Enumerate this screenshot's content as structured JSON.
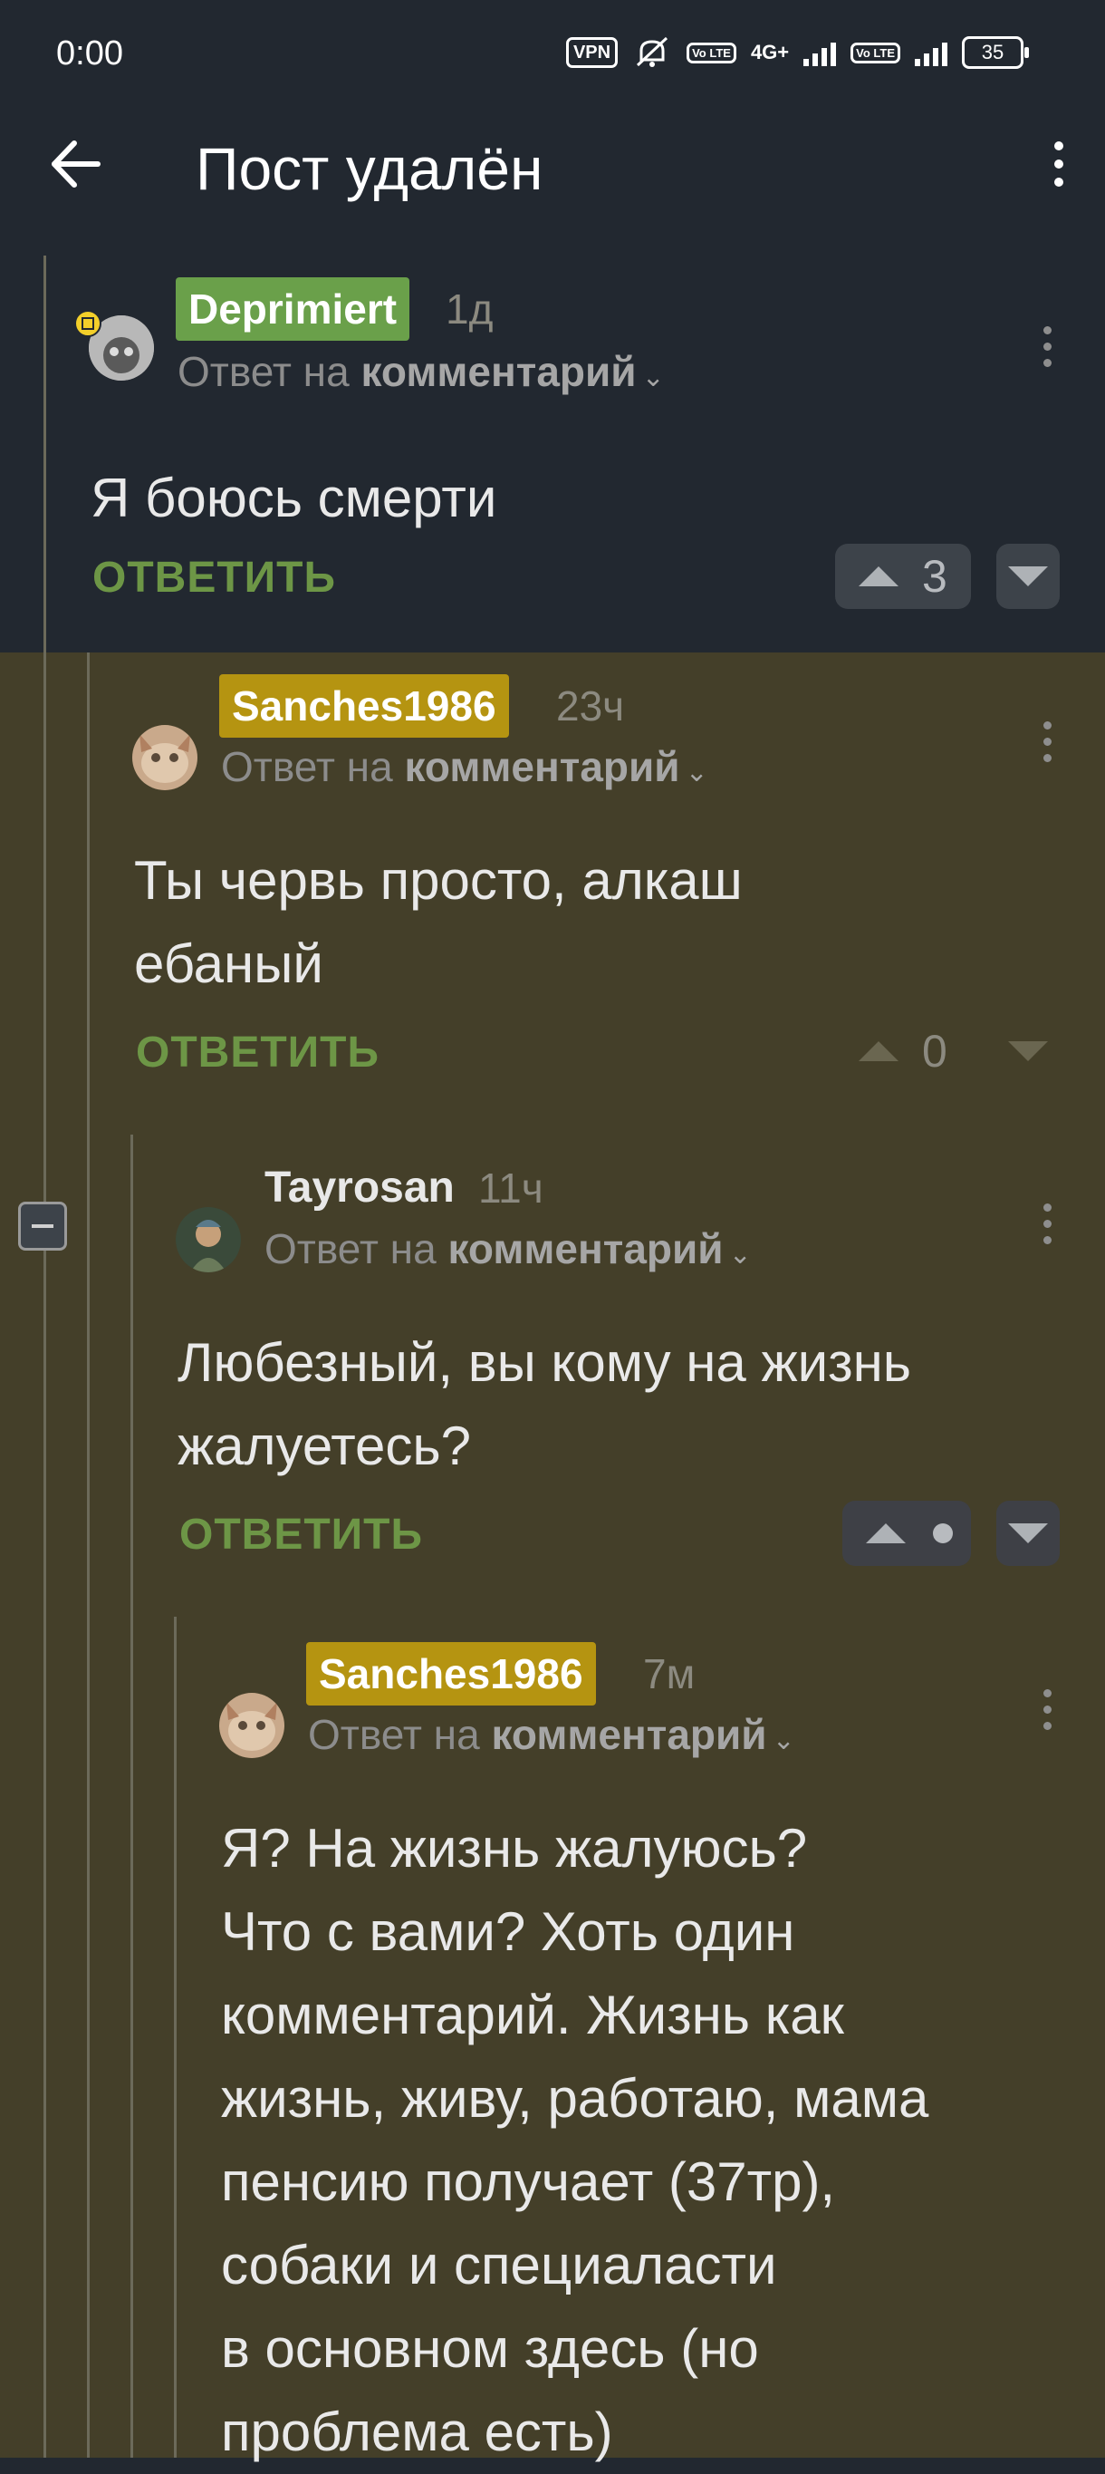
{
  "status": {
    "time": "0:00",
    "vpn": "VPN",
    "volte1": "Vo LTE",
    "net": "4G+",
    "volte2": "Vo LTE",
    "battery": "35"
  },
  "header": {
    "title": "Пост удалён",
    "back_icon": "arrow-left-icon",
    "menu_icon": "more-vertical-icon"
  },
  "comments": [
    {
      "nick": "Deprimiert",
      "nick_color": "#6aa04a",
      "time": "1д",
      "reply_prefix": "Ответ на",
      "reply_target": "комментарий",
      "text": "Я боюсь смерти",
      "reply_label": "ОТВЕТИТЬ",
      "votes": "3"
    },
    {
      "nick": "Sanches1986",
      "nick_color": "#b59411",
      "time": "23ч",
      "reply_prefix": "Ответ на",
      "reply_target": "комментарий",
      "text_line1": "Ты червь просто, алкаш",
      "text_line2": "ебаный",
      "reply_label": "ОТВЕТИТЬ",
      "votes": "0"
    },
    {
      "nick": "Tayrosan",
      "time": "11ч",
      "reply_prefix": "Ответ на",
      "reply_target": "комментарий",
      "text_line1": "Любезный, вы кому на жизнь",
      "text_line2": "жалуетесь?",
      "reply_label": "ОТВЕТИТЬ"
    },
    {
      "nick": "Sanches1986",
      "nick_color": "#b59411",
      "time": "7м",
      "reply_prefix": "Ответ на",
      "reply_target": "комментарий",
      "lines": [
        "Я? На жизнь жалуюсь?",
        "Что с вами? Хоть один",
        "комментарий. Жизнь как",
        "жизнь, живу, работаю, мама",
        "пенсию получает (37тр),",
        "собаки и специаласти",
        "в основном здесь (но",
        "проблема есть)"
      ]
    }
  ],
  "colors": {
    "dark_bg": "#222830",
    "olive_bg": "#443f29",
    "reply_green": "#6d9646"
  }
}
